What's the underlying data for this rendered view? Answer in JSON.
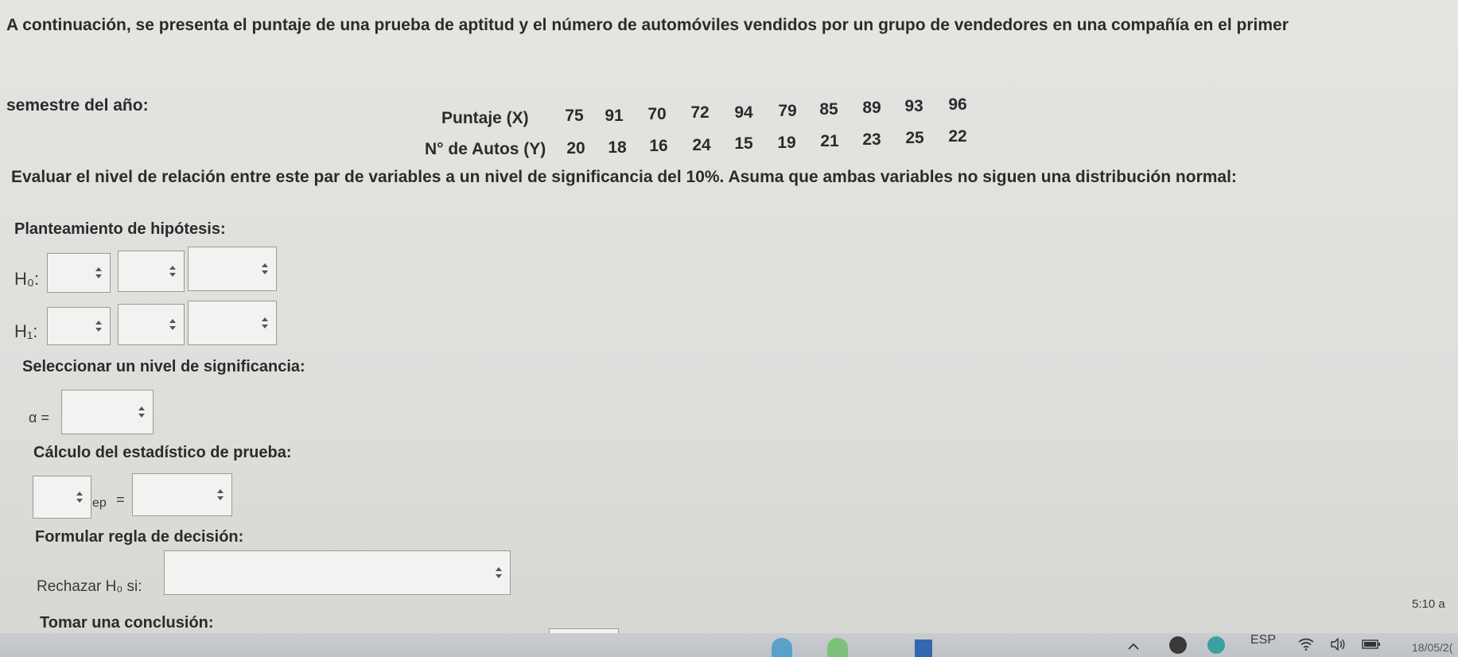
{
  "intro": {
    "line1": "A continuación, se presenta el puntaje de una prueba de aptitud y el número de automóviles vendidos por un grupo de vendedores en una compañía en el primer",
    "line2": "semestre del año:"
  },
  "data_table": {
    "row_x_label": "Puntaje (X)",
    "row_y_label": "N° de Autos (Y)",
    "x_values": [
      "75",
      "91",
      "70",
      "72",
      "94",
      "79",
      "85",
      "89",
      "93",
      "96"
    ],
    "y_values": [
      "20",
      "18",
      "16",
      "24",
      "15",
      "19",
      "21",
      "23",
      "25",
      "22"
    ]
  },
  "instruction": "Evaluar el nivel de relación entre este par de variables a un nivel de significancia del 10%. Asuma que ambas variables no siguen una distribución normal:",
  "hypothesis": {
    "title": "Planteamiento de hipótesis:",
    "h0_label": "H₀:",
    "h1_label": "H₁:"
  },
  "significance": {
    "title": "Seleccionar un nivel de significancia:",
    "alpha_label": "α ="
  },
  "statistic": {
    "title": "Cálculo del estadístico de prueba:",
    "subscript_label": "ep",
    "equals": "="
  },
  "decision": {
    "title": "Formular regla de decisión:",
    "reject_label": "Rechazar H₀ si:"
  },
  "conclusion": {
    "title": "Tomar una conclusión:"
  },
  "taskbar": {
    "language": "ESP",
    "time": "5:10 a",
    "date": "18/05/2("
  },
  "colors": {
    "background": "#e0e0dd",
    "select_bg": "#f2f2f0",
    "select_border": "#9a9a98",
    "text": "#2b2b2b"
  },
  "icons": {
    "select_arrows": "up-down-chevron",
    "wifi": "wifi-icon",
    "volume": "volume-icon",
    "battery": "battery-icon"
  }
}
